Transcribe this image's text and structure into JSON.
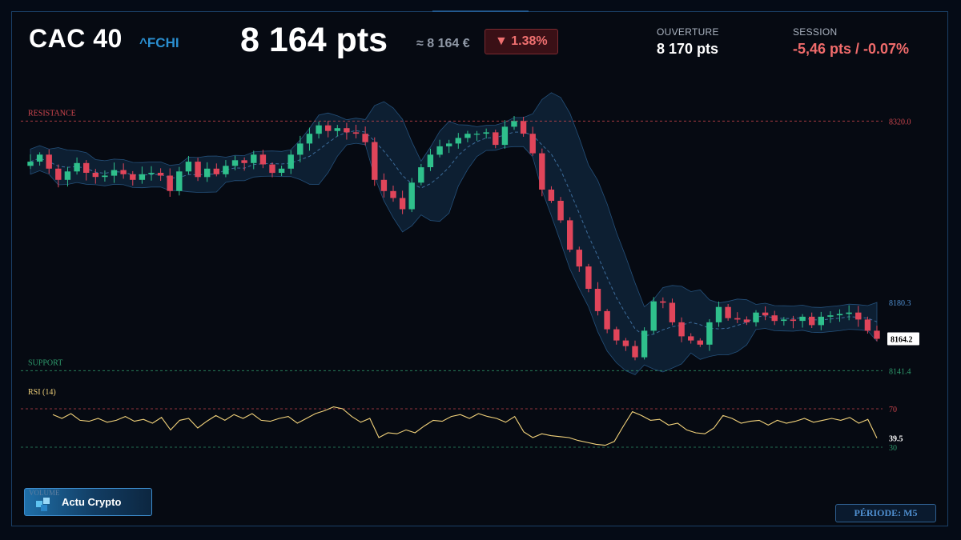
{
  "header": {
    "index_name": "CAC 40",
    "ticker": "^FCHI",
    "price": "8 164 pts",
    "price_approx": "≈ 8 164 €",
    "change": "▼ 1.38%",
    "open_label": "OUVERTURE",
    "open_value": "8 170 pts",
    "session_label": "SESSION",
    "session_value": "-5,46 pts / -0.07%"
  },
  "footer": {
    "brand": "Actu Crypto",
    "volume_label": "VOLUME",
    "period": "PÉRIODE: M5"
  },
  "colors": {
    "up": "#2fc08c",
    "down": "#e0455a",
    "resistance": "#d0464e",
    "support": "#2e9a6c",
    "rsi_line": "#f2d27a",
    "band_fill": "#14324c",
    "ticker": "#2a8fd0"
  },
  "chart_data": [
    {
      "type": "line",
      "title": "",
      "series": [
        {
          "name": "",
          "values": [
            8291,
            8296,
            8286,
            8278,
            8284,
            8290,
            8283,
            8280,
            8281,
            8285,
            8282,
            8278,
            8282,
            8283,
            8281,
            8270,
            8284,
            8291,
            8280,
            8286,
            8282,
            8288,
            8292,
            8290,
            8296,
            8289,
            8283,
            8286,
            8296,
            8304,
            8311,
            8317,
            8313,
            8315,
            8312,
            8311,
            8305,
            8278,
            8270,
            8265,
            8257,
            8276,
            8287,
            8296,
            8302,
            8304,
            8308,
            8311,
            8311,
            8312,
            8303,
            8316,
            8320,
            8311,
            8297,
            8271,
            8263,
            8249,
            8228,
            8216,
            8200,
            8184,
            8171,
            8163,
            8159,
            8151,
            8170,
            8191,
            8190,
            8176,
            8166,
            8163,
            8160,
            8176,
            8187,
            8179,
            8178,
            8176,
            8183,
            8181,
            8177,
            8178,
            8177,
            8180,
            8174,
            8180,
            8181,
            8182,
            8183,
            8178,
            8170,
            8164.2
          ]
        }
      ],
      "annotations": {
        "resistance_label": "RESISTANCE",
        "resistance": "8320.0",
        "support_label": "SUPPORT",
        "support": "8141.4",
        "upper_band_label": "8180.3",
        "last_price": "8164.2"
      },
      "indicators": [
        "bollinger-bands"
      ],
      "ylim": [
        8133,
        8338
      ],
      "grid": false
    },
    {
      "type": "line",
      "title": "RSI (14)",
      "series": [
        {
          "name": "",
          "values": [
            64,
            60,
            65,
            58,
            57,
            60,
            56,
            58,
            62,
            57,
            59,
            55,
            61,
            48,
            58,
            60,
            50,
            57,
            63,
            58,
            64,
            60,
            65,
            58,
            57,
            60,
            62,
            55,
            60,
            65,
            68,
            72,
            70,
            62,
            56,
            60,
            40,
            45,
            44,
            48,
            45,
            52,
            58,
            57,
            62,
            64,
            60,
            65,
            62,
            60,
            56,
            62,
            46,
            40,
            44,
            42,
            41,
            40,
            37,
            35,
            33,
            32,
            36,
            52,
            67,
            63,
            58,
            59,
            53,
            55,
            48,
            45,
            44,
            50,
            63,
            60,
            55,
            57,
            58,
            53,
            58,
            55,
            57,
            60,
            56,
            58,
            60,
            58,
            61,
            55,
            59,
            39.5
          ]
        }
      ],
      "levels": [
        "70",
        "30"
      ],
      "last_value": "39.5",
      "ylim": [
        25,
        75
      ]
    }
  ]
}
